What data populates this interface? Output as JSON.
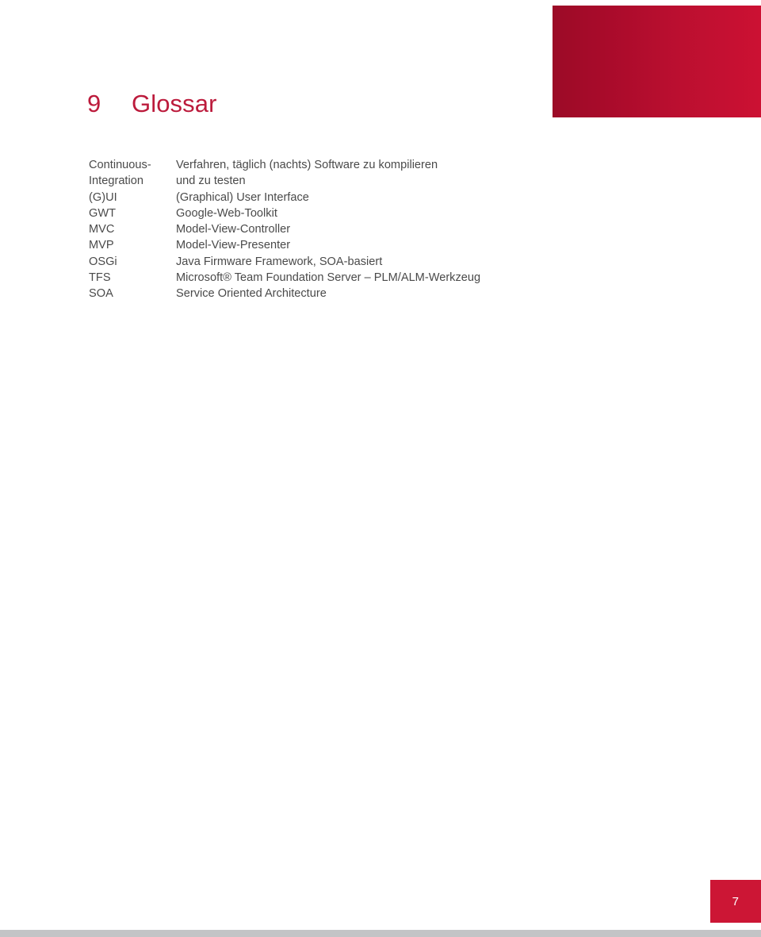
{
  "page": {
    "background_color": "#ffffff",
    "accent_color": "#bc1b3c",
    "banner_gradient_from": "#9c0b27",
    "banner_gradient_to": "#cc1133",
    "text_color": "#4a4a4a"
  },
  "header": {
    "banner_name": "decorative-red-gradient-banner"
  },
  "heading": {
    "number": "9",
    "title": "Glossar"
  },
  "glossary": {
    "rows": [
      {
        "term": "Continuous-",
        "definition": "Verfahren, täglich (nachts) Software zu kompilieren"
      },
      {
        "term": "Integration",
        "definition": "und zu testen"
      },
      {
        "term": "(G)UI",
        "definition": "(Graphical) User Interface"
      },
      {
        "term": "GWT",
        "definition": "Google-Web-Toolkit"
      },
      {
        "term": "MVC",
        "definition": "Model-View-Controller"
      },
      {
        "term": "MVP",
        "definition": "Model-View-Presenter"
      },
      {
        "term": "OSGi",
        "definition": "Java Firmware Framework, SOA-basiert"
      },
      {
        "term": "TFS",
        "definition": "Microsoft® Team Foundation Server – PLM/ALM-Werkzeug"
      },
      {
        "term": "SOA",
        "definition": "Service Oriented Architecture"
      }
    ]
  },
  "footer": {
    "page_number": "7"
  }
}
